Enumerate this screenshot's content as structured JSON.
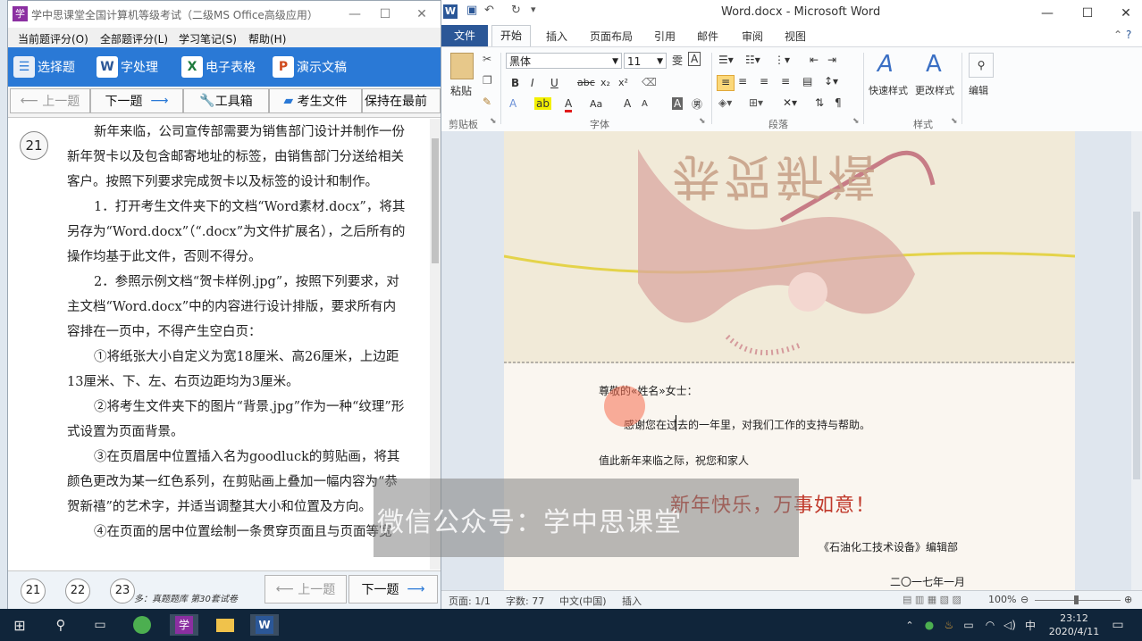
{
  "exam": {
    "title": "学中思课堂全国计算机等级考试（二级MS Office高级应用）",
    "menu": [
      "当前题评分(O)",
      "全部题评分(L)",
      "学习笔记(S)",
      "帮助(H)"
    ],
    "tools": [
      "选择题",
      "字处理",
      "电子表格",
      "演示文稿"
    ],
    "nav": {
      "prev": "上一题",
      "next": "下一题",
      "toolbox": "工具箱",
      "folder": "考生文件",
      "front": "保持在最前"
    },
    "question_number": "21",
    "paragraphs": [
      "新年来临，公司宣传部需要为销售部门设计并制作一份新年贺卡以及包含邮寄地址的标签，由销售部门分送给相关客户。按照下列要求完成贺卡以及标签的设计和制作。",
      "1．打开考生文件夹下的文档“Word素材.docx”，将其另存为“Word.docx”（“.docx”为文件扩展名），之后所有的操作均基于此文件，否则不得分。",
      "2．参照示例文档“贺卡样例.jpg”，按照下列要求，对主文档“Word.docx”中的内容进行设计排版，要求所有内容排在一页中，不得产生空白页：",
      "①将纸张大小自定义为宽18厘米、高26厘米，上边距13厘米、下、左、右页边距均为3厘米。",
      "②将考生文件夹下的图片“背景.jpg”作为一种“纹理”形式设置为页面背景。",
      "③在页眉居中位置插入名为goodluck的剪贴画，将其颜色更改为某一红色系列，在剪贴画上叠加一幅内容为“恭贺新禧”的艺术字，并适当调整其大小和位置及方向。",
      "④在页面的居中位置绘制一条贯穿页面且与页面等宽"
    ],
    "bottom": {
      "q1": "21",
      "q2": "22",
      "q3": "23",
      "footnote": "多：真题题库 第30套试卷",
      "prev": "上一题",
      "next": "下一题"
    }
  },
  "word": {
    "title": "Word.docx - Microsoft Word",
    "tabs": [
      "文件",
      "开始",
      "插入",
      "页面布局",
      "引用",
      "邮件",
      "审阅",
      "视图"
    ],
    "font_name": "黑体",
    "font_size": "11",
    "paste_label": "粘贴",
    "quick_style": "快速样式",
    "change_style": "更改样式",
    "edit_label": "编辑",
    "groups": [
      "剪贴板",
      "字体",
      "段落",
      "样式"
    ],
    "doc": {
      "salutation": "尊敬的«姓名»女士：",
      "line1": "感谢您在过去的一年里，对我们工作的支持与帮助。",
      "line2": "值此新年来临之际，祝您和家人",
      "greeting": "新年快乐，万事如意！",
      "signature": "《石油化工技术设备》编辑部",
      "date": "二〇一七年一月",
      "header_art": "恭贺新禧"
    },
    "status": {
      "page": "页面: 1/1",
      "words": "字数: 77",
      "lang": "中文(中国)",
      "mode": "插入",
      "zoom": "100%"
    }
  },
  "watermark": "微信公众号：学中思课堂",
  "taskbar": {
    "time": "23:12",
    "date": "2020/4/11",
    "ime": "中"
  },
  "colors": {
    "exam_toolbar": "#2a79d6",
    "word_file_tab": "#2b5797",
    "greeting_red": "#c0392b"
  }
}
